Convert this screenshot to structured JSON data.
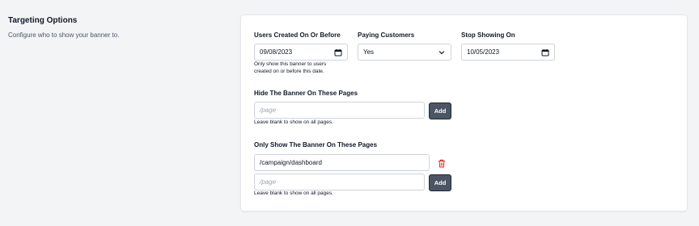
{
  "section": {
    "title": "Targeting Options",
    "description": "Configure who to show your banner to."
  },
  "users_created": {
    "label": "Users Created On Or Before",
    "value": "09/08/2023",
    "help_line1": "Only show this banner to users",
    "help_line2": "created on or before this date."
  },
  "paying_customers": {
    "label": "Paying Customers",
    "value": "Yes"
  },
  "stop_showing": {
    "label": "Stop Showing On",
    "value": "10/05/2023"
  },
  "hide_pages": {
    "label": "Hide The Banner On These Pages",
    "placeholder": "/page",
    "add_label": "Add",
    "help": "Leave blank to show on all pages."
  },
  "only_show_pages": {
    "label": "Only Show The Banner On These Pages",
    "entries": [
      "/campaign/dashboard"
    ],
    "placeholder": "/page",
    "add_label": "Add",
    "help": "Leave blank to show on all pages."
  },
  "colors": {
    "button_bg": "#4b5563",
    "delete_icon": "#dc2626",
    "page_bg": "#f3f4f6"
  }
}
